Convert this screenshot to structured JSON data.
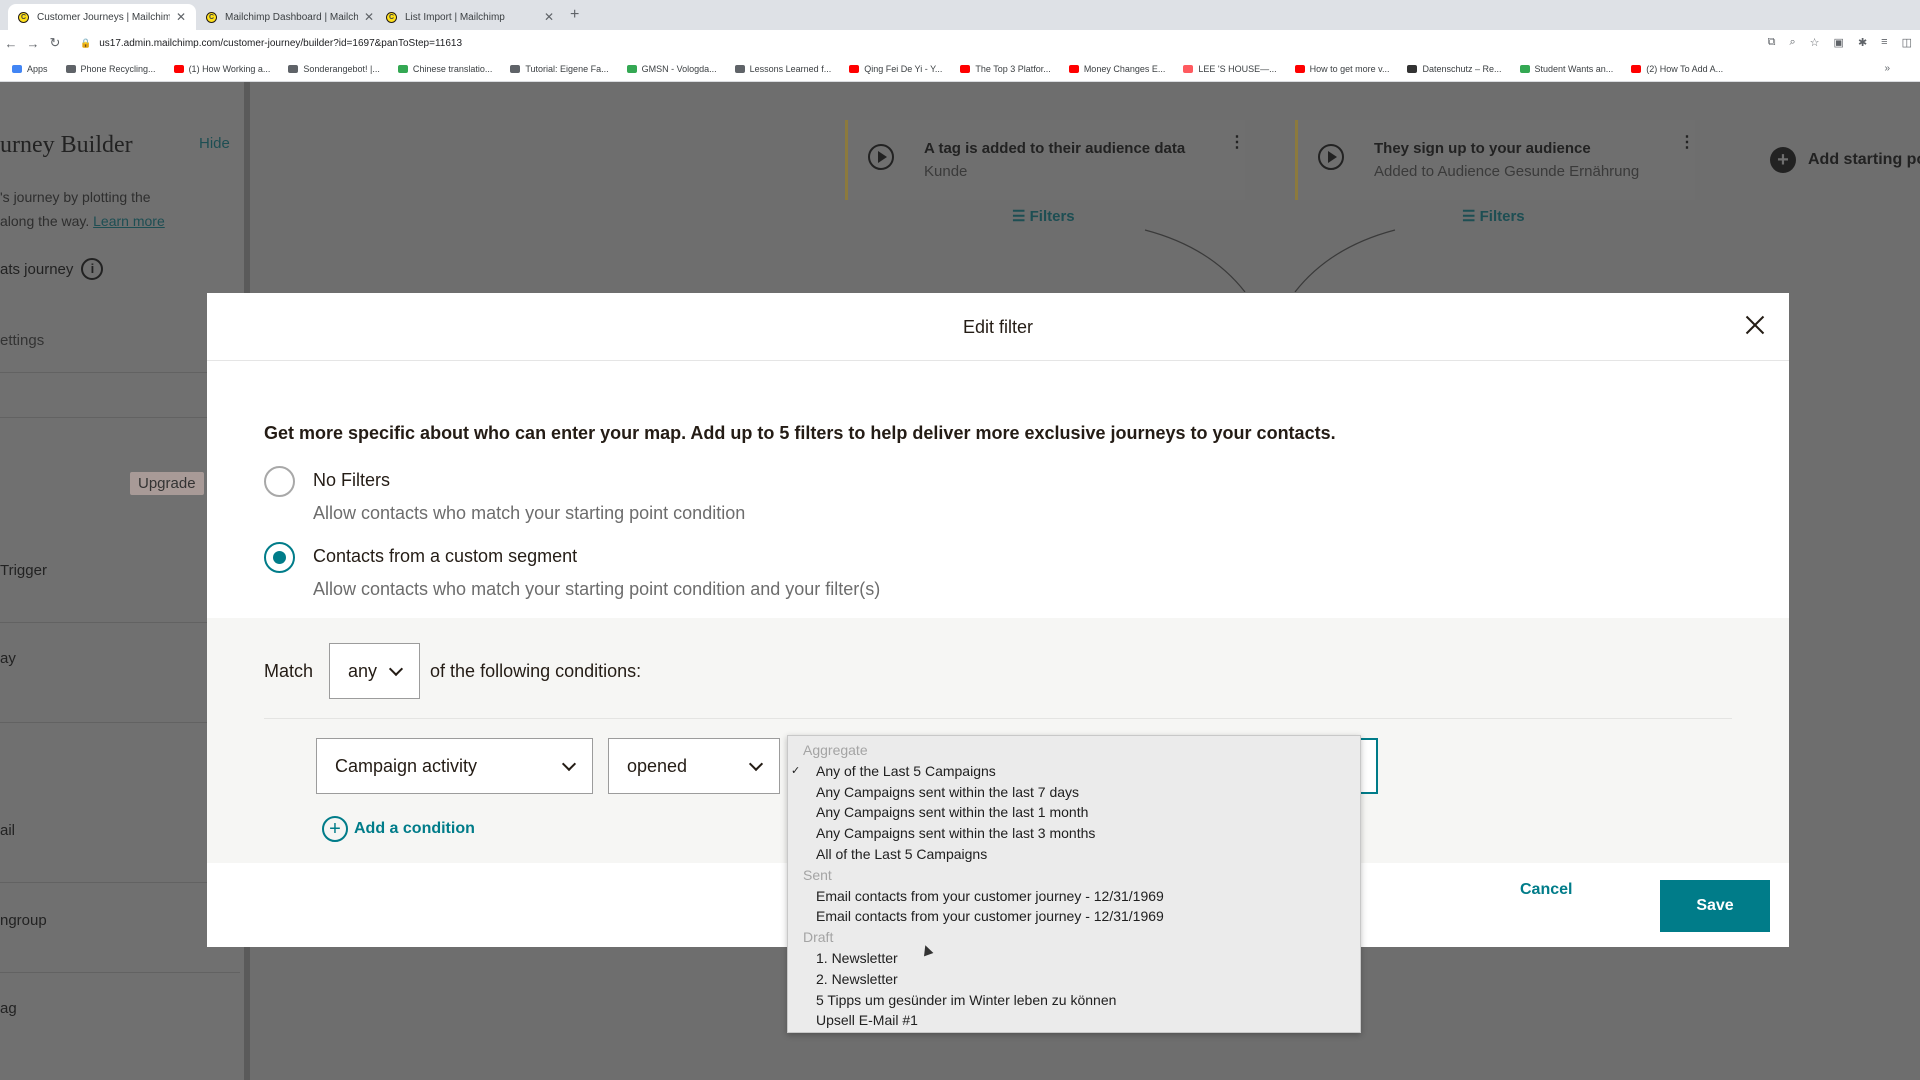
{
  "browser": {
    "tabs": [
      {
        "title": "Customer Journeys | Mailchim",
        "active": true
      },
      {
        "title": "Mailchimp Dashboard | Mailch",
        "active": false
      },
      {
        "title": "List Import | Mailchimp",
        "active": false
      }
    ],
    "new_tab": "+",
    "url": "us17.admin.mailchimp.com/customer-journey/builder?id=1697&panToStep=11613",
    "bookmarks": [
      {
        "label": "Apps",
        "color": "#4285f4"
      },
      {
        "label": "Phone Recycling...",
        "color": "#5f6368"
      },
      {
        "label": "(1) How Working a...",
        "color": "#ff0000"
      },
      {
        "label": "Sonderangebot! |...",
        "color": "#5f6368"
      },
      {
        "label": "Chinese translatio...",
        "color": "#34a853"
      },
      {
        "label": "Tutorial: Eigene Fa...",
        "color": "#5f6368"
      },
      {
        "label": "GMSN - Vologda...",
        "color": "#34a853"
      },
      {
        "label": "Lessons Learned f...",
        "color": "#5f6368"
      },
      {
        "label": "Qing Fei De Yi - Y...",
        "color": "#ff0000"
      },
      {
        "label": "The Top 3 Platfor...",
        "color": "#ff0000"
      },
      {
        "label": "Money Changes E...",
        "color": "#ff0000"
      },
      {
        "label": "LEE 'S HOUSE—...",
        "color": "#ff5a5f"
      },
      {
        "label": "How to get more v...",
        "color": "#ff0000"
      },
      {
        "label": "Datenschutz – Re...",
        "color": "#333333"
      },
      {
        "label": "Student Wants an...",
        "color": "#34a853"
      },
      {
        "label": "(2) How To Add A...",
        "color": "#ff0000"
      }
    ]
  },
  "sidebar": {
    "title": "urney Builder",
    "hide": "Hide",
    "desc_line1": "'s journey by plotting the",
    "desc_line2": "along the way.",
    "learn_more": "Learn more",
    "stats": "ats journey",
    "settings": "ettings",
    "upgrade": "Upgrade",
    "items": [
      "Trigger",
      "ay",
      "ail",
      "ngroup",
      "ag"
    ]
  },
  "canvas": {
    "cards": [
      {
        "title": "A tag is added to their audience data",
        "subtitle": "Kunde",
        "filters": "Filters"
      },
      {
        "title": "They sign up to your audience",
        "subtitle": "Added to Audience Gesunde Ernährung",
        "filters": "Filters"
      }
    ],
    "add_start": "Add starting po"
  },
  "modal": {
    "title": "Edit filter",
    "intro": "Get more specific about who can enter your map. Add up to 5 filters to help deliver more exclusive journeys to your contacts.",
    "options": [
      {
        "label": "No Filters",
        "desc": "Allow contacts who match your starting point condition",
        "checked": false
      },
      {
        "label": "Contacts from a custom segment",
        "desc": "Allow contacts who match your starting point condition and your filter(s)",
        "checked": true
      }
    ],
    "match_label": "Match",
    "match_value": "any",
    "match_suffix": "of the following conditions:",
    "condition_field": "Campaign activity",
    "condition_operator": "opened",
    "add_condition": "Add a condition",
    "cancel": "Cancel",
    "save": "Save"
  },
  "dropdown": {
    "groups": [
      {
        "label": "Aggregate",
        "options": [
          {
            "text": "Any of the Last 5 Campaigns",
            "selected": true
          },
          {
            "text": "Any Campaigns sent within the last 7 days"
          },
          {
            "text": "Any Campaigns sent within the last 1 month"
          },
          {
            "text": "Any Campaigns sent within the last 3 months"
          },
          {
            "text": "All of the Last 5 Campaigns"
          }
        ]
      },
      {
        "label": "Sent",
        "options": [
          {
            "text": "Email contacts from your customer journey - 12/31/1969"
          },
          {
            "text": "Email contacts from your customer journey - 12/31/1969"
          }
        ]
      },
      {
        "label": "Draft",
        "options": [
          {
            "text": "1. Newsletter"
          },
          {
            "text": "2. Newsletter"
          },
          {
            "text": "5 Tipps um gesünder im Winter leben zu können"
          },
          {
            "text": "Upsell E-Mail #1"
          }
        ]
      }
    ]
  },
  "colors": {
    "accent": "#007c89",
    "brand": "#ffe01b"
  }
}
